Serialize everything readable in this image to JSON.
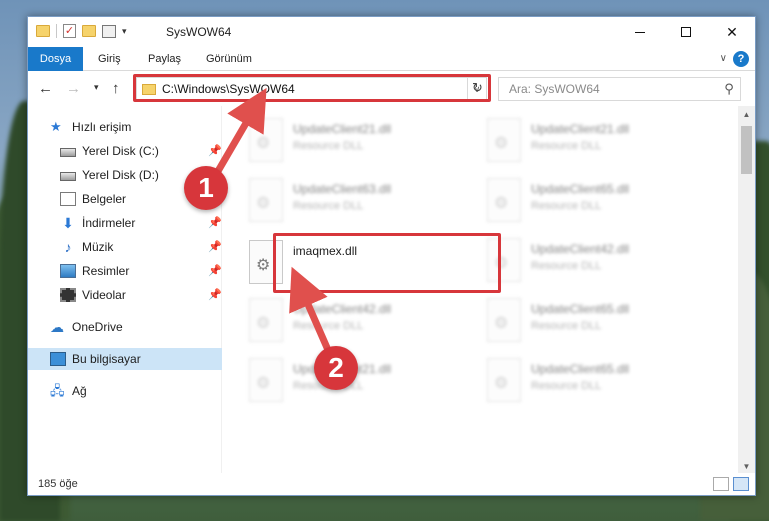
{
  "window": {
    "title": "SysWOW64",
    "minimize_icon": "minimize-icon",
    "maximize_icon": "maximize-icon",
    "close_icon": "close-icon"
  },
  "ribbon": {
    "tabs": [
      "Dosya",
      "Giriş",
      "Paylaş",
      "Görünüm"
    ],
    "help_label": "?"
  },
  "nav": {
    "address": "C:\\Windows\\SysWOW64",
    "search_placeholder": "Ara: SysWOW64"
  },
  "sidebar": {
    "items": [
      {
        "label": "Hızlı erişim",
        "icon": "star-icon",
        "pinned": false
      },
      {
        "label": "Yerel Disk (C:)",
        "icon": "drive-icon",
        "pinned": true
      },
      {
        "label": "Yerel Disk (D:)",
        "icon": "drive-icon",
        "pinned": true
      },
      {
        "label": "Belgeler",
        "icon": "documents-icon",
        "pinned": true
      },
      {
        "label": "İndirmeler",
        "icon": "download-icon",
        "pinned": true
      },
      {
        "label": "Müzik",
        "icon": "music-icon",
        "pinned": true
      },
      {
        "label": "Resimler",
        "icon": "pictures-icon",
        "pinned": true
      },
      {
        "label": "Videolar",
        "icon": "videos-icon",
        "pinned": true
      },
      {
        "label": "OneDrive",
        "icon": "onedrive-icon",
        "pinned": false
      },
      {
        "label": "Bu bilgisayar",
        "icon": "this-pc-icon",
        "pinned": false,
        "selected": true
      },
      {
        "label": "Ağ",
        "icon": "network-icon",
        "pinned": false
      }
    ]
  },
  "files": {
    "highlighted": {
      "name": "imaqmex.dll"
    },
    "blurred": [
      {
        "name": "UpdateClient21.dll",
        "type": "Resource DLL"
      },
      {
        "name": "UpdateClient21.dll",
        "type": "Resource DLL"
      },
      {
        "name": "UpdateClient63.dll",
        "type": "Resource DLL"
      },
      {
        "name": "UpdateClient65.dll",
        "type": "Resource DLL"
      },
      {
        "name": "UpdateClient42.dll",
        "type": "Resource DLL"
      },
      {
        "name": "UpdateClient42.dll",
        "type": "Resource DLL"
      },
      {
        "name": "UpdateClient65.dll",
        "type": "Resource DLL"
      },
      {
        "name": "UpdateClient21.dll",
        "type": "Resource DLL"
      },
      {
        "name": "UpdateClient65.dll",
        "type": "Resource DLL"
      }
    ]
  },
  "status": {
    "count": "185 öğe"
  },
  "callouts": {
    "step1": "1",
    "step2": "2"
  },
  "colors": {
    "accent": "#1979ca",
    "highlight": "#d7363b",
    "selection": "#cce4f7"
  }
}
